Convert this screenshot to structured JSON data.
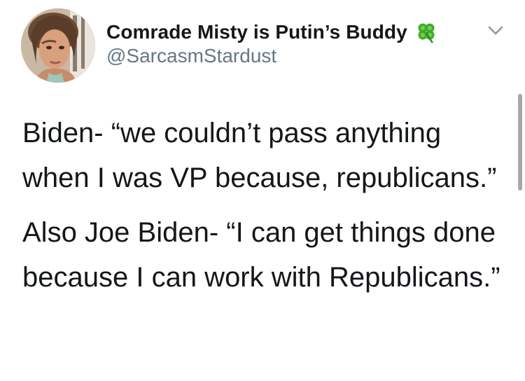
{
  "author": {
    "display_name": "Comrade Misty is Putin’s Buddy",
    "handle": "@SarcasmStardust",
    "name_emoji": "four-leaf-clover-icon"
  },
  "tweet": {
    "paragraphs": [
      "Biden- “we couldn’t pass anything when I was VP because, republicans.”",
      "Also Joe Biden- “I can get things done because I can work with Republicans.”"
    ]
  },
  "colors": {
    "text": "#14171a",
    "secondary_text": "#657786",
    "clover": "#3fae2a",
    "chevron": "#8899a6"
  }
}
